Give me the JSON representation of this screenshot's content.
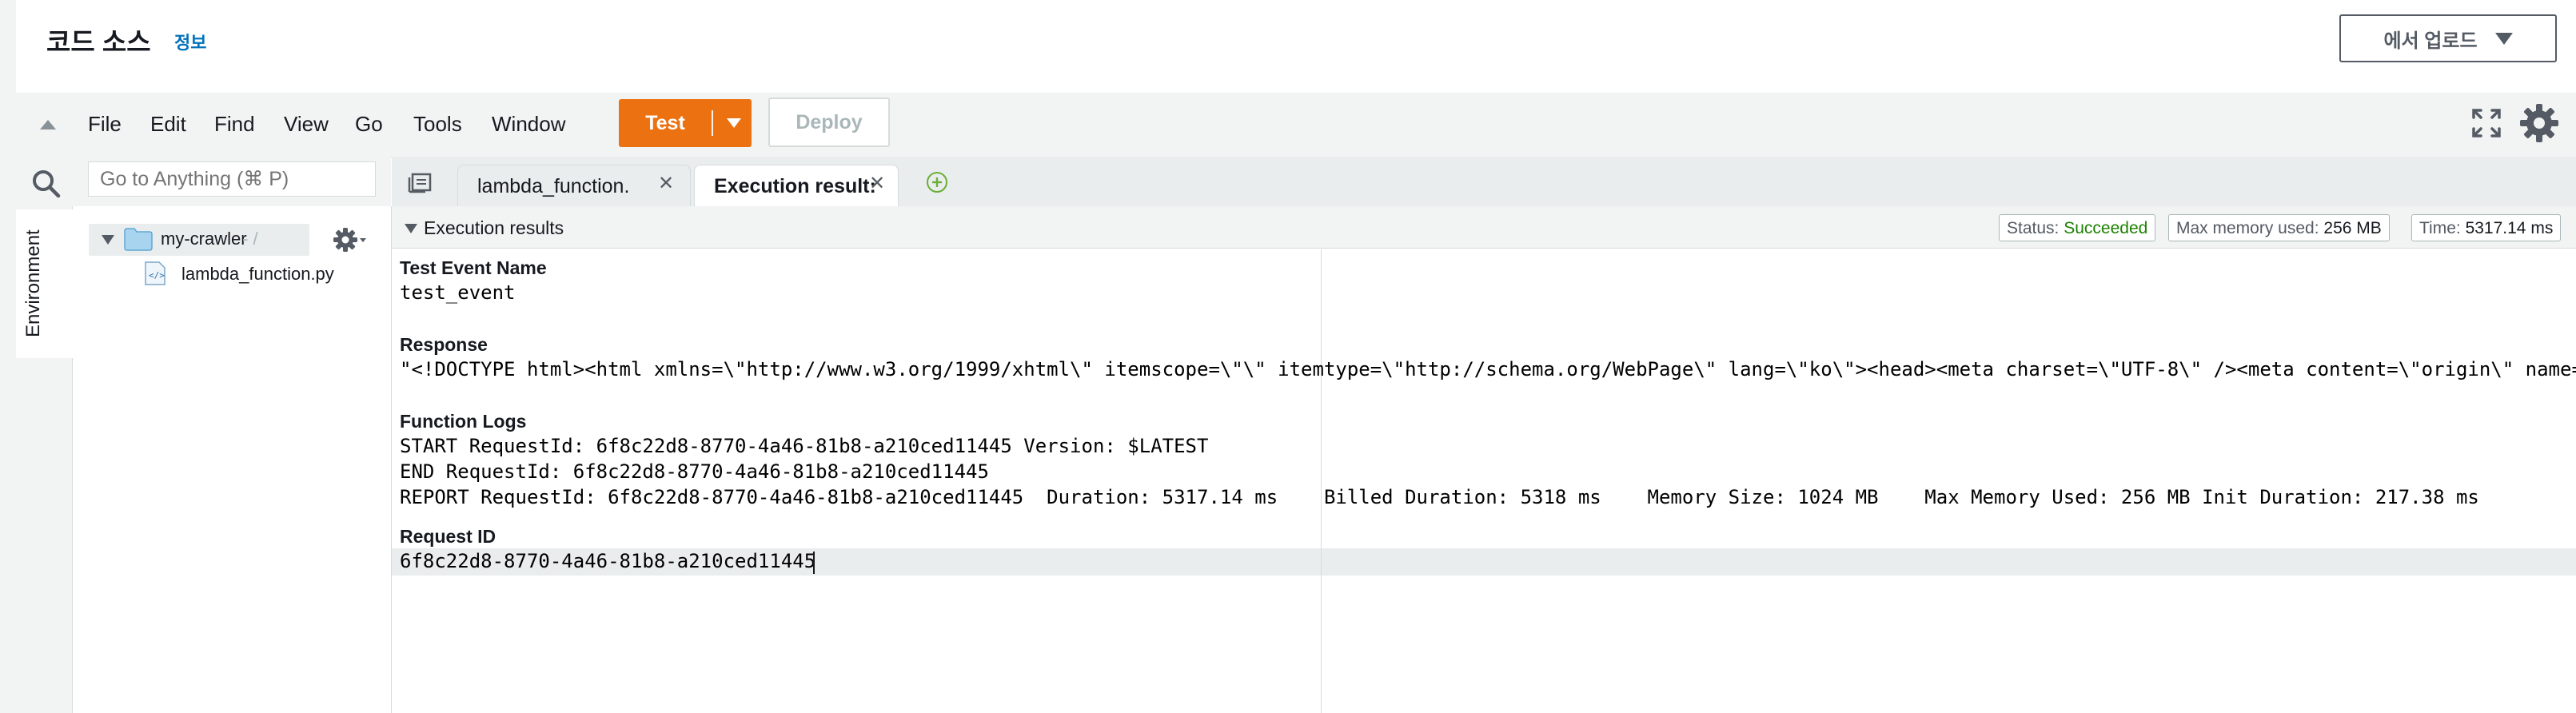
{
  "header": {
    "title": "코드 소스",
    "info_link": "정보",
    "upload_label": "에서 업로드"
  },
  "toolbar": {
    "menus": [
      "File",
      "Edit",
      "Find",
      "View",
      "Go",
      "Tools",
      "Window"
    ],
    "test_label": "Test",
    "deploy_label": "Deploy"
  },
  "nav": {
    "search_placeholder": "Go to Anything (⌘ P)",
    "env_tab": "Environment",
    "folder_name": "my-crawler",
    "folder_path": "- /",
    "file_name": "lambda_function.py"
  },
  "tabs": [
    {
      "label": "lambda_function.",
      "active": false
    },
    {
      "label": "Execution result:",
      "active": true
    }
  ],
  "results": {
    "title": "Execution results",
    "status_label": "Status:",
    "status_value": "Succeeded",
    "memory_label": "Max memory used:",
    "memory_value": "256 MB",
    "time_label": "Time:",
    "time_value": "5317.14 ms",
    "sections": {
      "test_event_label": "Test Event Name",
      "test_event_value": "test_event",
      "response_label": "Response",
      "response_value": "\"<!DOCTYPE html><html xmlns=\\\"http://www.w3.org/1999/xhtml\\\" itemscope=\\\"\\\" itemtype=\\\"http://schema.org/WebPage\\\" lang=\\\"ko\\\"><head><meta charset=\\\"UTF-8\\\" /><meta content=\\\"origin\\\" name=",
      "function_logs_label": "Function Logs",
      "log_lines": [
        "START RequestId: 6f8c22d8-8770-4a46-81b8-a210ced11445 Version: $LATEST",
        "END RequestId: 6f8c22d8-8770-4a46-81b8-a210ced11445",
        "REPORT RequestId: 6f8c22d8-8770-4a46-81b8-a210ced11445  Duration: 5317.14 ms    Billed Duration: 5318 ms    Memory Size: 1024 MB    Max Memory Used: 256 MB Init Duration: 217.38 ms"
      ],
      "request_id_label": "Request ID",
      "request_id_value": "6f8c22d8-8770-4a46-81b8-a210ced11445"
    }
  },
  "colors": {
    "accent": "#ec7211",
    "link": "#0073bb",
    "success": "#1d8102"
  },
  "icons": [
    "collapse-icon",
    "fullscreen-icon",
    "settings-icon",
    "search-icon",
    "folder-icon",
    "python-file-icon",
    "gear-icon",
    "tab-list-icon",
    "add-tab-icon",
    "close-icon"
  ]
}
